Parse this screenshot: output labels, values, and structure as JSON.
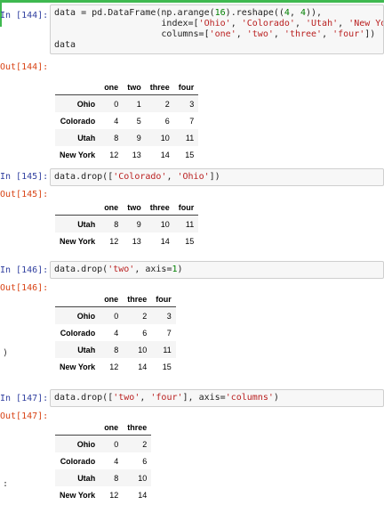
{
  "cells": [
    {
      "in_prompt": "In [144]:",
      "code": [
        [
          {
            "t": "data = pd.DataFrame(np.arange("
          },
          {
            "t": "16",
            "c": "num"
          },
          {
            "t": ").reshape(("
          },
          {
            "t": "4",
            "c": "num"
          },
          {
            "t": ", "
          },
          {
            "t": "4",
            "c": "num"
          },
          {
            "t": ")),"
          }
        ],
        [
          {
            "t": "                    index=["
          },
          {
            "t": "'Ohio'",
            "c": "str"
          },
          {
            "t": ", "
          },
          {
            "t": "'Colorado'",
            "c": "str"
          },
          {
            "t": ", "
          },
          {
            "t": "'Utah'",
            "c": "str"
          },
          {
            "t": ", "
          },
          {
            "t": "'New York'",
            "c": "str"
          },
          {
            "t": "],"
          }
        ],
        [
          {
            "t": "                    columns=["
          },
          {
            "t": "'one'",
            "c": "str"
          },
          {
            "t": ", "
          },
          {
            "t": "'two'",
            "c": "str"
          },
          {
            "t": ", "
          },
          {
            "t": "'three'",
            "c": "str"
          },
          {
            "t": ", "
          },
          {
            "t": "'four'",
            "c": "str"
          },
          {
            "t": "])"
          }
        ],
        [
          {
            "t": "data"
          }
        ]
      ],
      "out_prompt": "Out[144]:",
      "table": {
        "columns": [
          "one",
          "two",
          "three",
          "four"
        ],
        "rows": [
          {
            "index": "Ohio",
            "values": [
              "0",
              "1",
              "2",
              "3"
            ]
          },
          {
            "index": "Colorado",
            "values": [
              "4",
              "5",
              "6",
              "7"
            ]
          },
          {
            "index": "Utah",
            "values": [
              "8",
              "9",
              "10",
              "11"
            ]
          },
          {
            "index": "New York",
            "values": [
              "12",
              "13",
              "14",
              "15"
            ]
          }
        ]
      }
    },
    {
      "in_prompt": "In [145]:",
      "code": [
        [
          {
            "t": "data.drop(["
          },
          {
            "t": "'Colorado'",
            "c": "str"
          },
          {
            "t": ", "
          },
          {
            "t": "'Ohio'",
            "c": "str"
          },
          {
            "t": "])"
          }
        ]
      ],
      "out_prompt": "Out[145]:",
      "table": {
        "columns": [
          "one",
          "two",
          "three",
          "four"
        ],
        "rows": [
          {
            "index": "Utah",
            "values": [
              "8",
              "9",
              "10",
              "11"
            ]
          },
          {
            "index": "New York",
            "values": [
              "12",
              "13",
              "14",
              "15"
            ]
          }
        ]
      }
    },
    {
      "in_prompt": "In [146]:",
      "code": [
        [
          {
            "t": "data.drop("
          },
          {
            "t": "'two'",
            "c": "str"
          },
          {
            "t": ", axis="
          },
          {
            "t": "1",
            "c": "num"
          },
          {
            "t": ")"
          }
        ]
      ],
      "out_prompt": "Out[146]:",
      "table": {
        "columns": [
          "one",
          "three",
          "four"
        ],
        "rows": [
          {
            "index": "Ohio",
            "values": [
              "0",
              "2",
              "3"
            ]
          },
          {
            "index": "Colorado",
            "values": [
              "4",
              "6",
              "7"
            ]
          },
          {
            "index": "Utah",
            "values": [
              "8",
              "10",
              "11"
            ]
          },
          {
            "index": "New York",
            "values": [
              "12",
              "14",
              "15"
            ]
          }
        ]
      }
    },
    {
      "in_prompt": "In [147]:",
      "code": [
        [
          {
            "t": "data.drop(["
          },
          {
            "t": "'two'",
            "c": "str"
          },
          {
            "t": ", "
          },
          {
            "t": "'four'",
            "c": "str"
          },
          {
            "t": "], axis="
          },
          {
            "t": "'columns'",
            "c": "str"
          },
          {
            "t": ")"
          }
        ]
      ],
      "out_prompt": "Out[147]:",
      "table": {
        "columns": [
          "one",
          "three"
        ],
        "rows": [
          {
            "index": "Ohio",
            "values": [
              "0",
              "2"
            ]
          },
          {
            "index": "Colorado",
            "values": [
              "4",
              "6"
            ]
          },
          {
            "index": "Utah",
            "values": [
              "8",
              "10"
            ]
          },
          {
            "index": "New York",
            "values": [
              "12",
              "14"
            ]
          }
        ]
      }
    }
  ],
  "side_marks": [
    ")",
    ":"
  ],
  "colors": {
    "accent": "#3fb950",
    "in_prompt": "#303f9f",
    "out_prompt": "#d84315",
    "string": "#ba2121",
    "number": "#008000"
  }
}
